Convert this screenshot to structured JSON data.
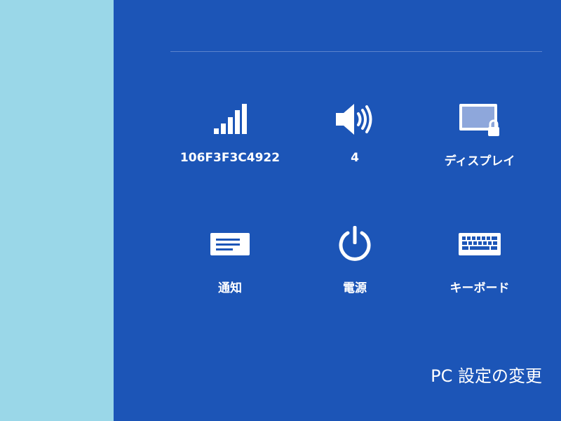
{
  "colors": {
    "desktop_background": "#9ad7e8",
    "charm_background": "#1c55b7",
    "divider": "#5b83cc",
    "text": "#ffffff"
  },
  "quick_settings": {
    "network": {
      "label": "106F3F3C4922",
      "icon": "wifi-signal-icon"
    },
    "volume": {
      "label": "4",
      "icon": "speaker-icon"
    },
    "display": {
      "label": "ディスプレイ",
      "icon": "display-lock-icon"
    },
    "notifications": {
      "label": "通知",
      "icon": "notification-icon"
    },
    "power": {
      "label": "電源",
      "icon": "power-icon"
    },
    "keyboard": {
      "label": "キーボード",
      "icon": "keyboard-icon"
    }
  },
  "footer": {
    "pc_settings_label": "PC 設定の変更"
  }
}
